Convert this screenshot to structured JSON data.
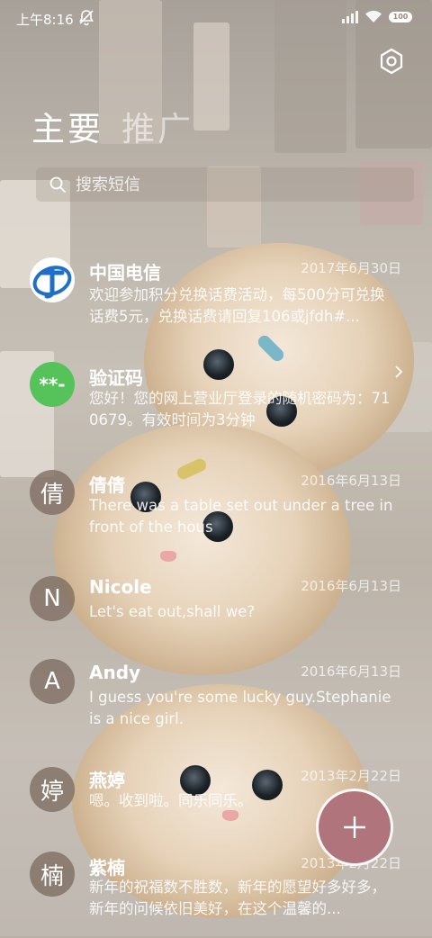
{
  "status_bar": {
    "time": "上午8:16",
    "battery": "100",
    "icons": [
      "mute-icon",
      "signal-icon",
      "wifi-icon",
      "battery-icon"
    ]
  },
  "header": {
    "tabs": [
      {
        "label": "主要",
        "active": true
      },
      {
        "label": "推广",
        "active": false
      }
    ],
    "settings_icon": "settings-hexagon-icon"
  },
  "search": {
    "placeholder": "搜索短信",
    "icon": "search-icon"
  },
  "conversations": [
    {
      "avatar_type": "telecom-logo",
      "avatar_text": "",
      "name": "中国电信",
      "date": "2017年6月30日",
      "preview": "欢迎参加积分兑换话费活动，每500分可兑换话费5元，兑换话费请回复106或jfdh#..."
    },
    {
      "avatar_type": "code",
      "avatar_text": "**-",
      "name": "验证码",
      "date": "",
      "preview": "您好！您的网上营业厅登录的随机密码为：710679。有效时间为3分钟"
    },
    {
      "avatar_type": "letter",
      "avatar_text": "倩",
      "name": "倩倩",
      "date": "2016年6月13日",
      "preview": "There was a table set out under a tree in front of the hous"
    },
    {
      "avatar_type": "letter",
      "avatar_text": "N",
      "name": "Nicole",
      "date": "2016年6月13日",
      "preview": "Let's eat out,shall we?"
    },
    {
      "avatar_type": "letter",
      "avatar_text": "A",
      "name": "Andy",
      "date": "2016年6月13日",
      "preview": "I guess you're some lucky guy.Stephanie is a nice girl."
    },
    {
      "avatar_type": "letter",
      "avatar_text": "婷",
      "name": "燕婷",
      "date": "2013年2月22日",
      "preview": "嗯。收到啦。同乐同乐。"
    },
    {
      "avatar_type": "letter",
      "avatar_text": "楠",
      "name": "紫楠",
      "date": "2013年2月22日",
      "preview": "新年的祝福数不胜数，新年的愿望好多好多，新年的问候依旧美好，在这个温馨的..."
    }
  ],
  "fab": {
    "icon": "plus-icon"
  },
  "colors": {
    "fab": "#b0757c",
    "code_avatar": "#55c25a",
    "telecom_blue": "#1f6fc7"
  }
}
